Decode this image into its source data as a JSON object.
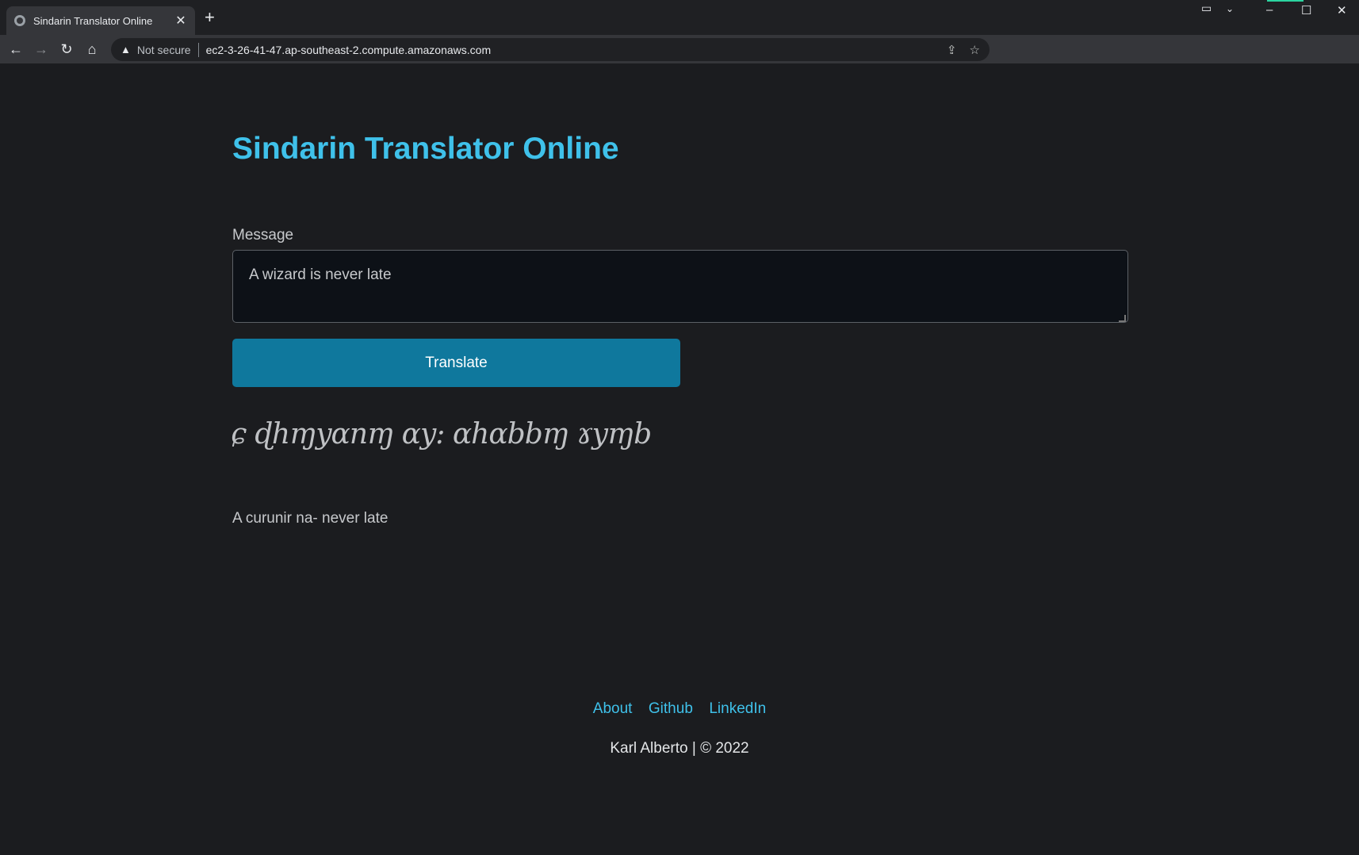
{
  "browser": {
    "tab_title": "Sindarin Translator Online",
    "tab_close": "✕",
    "new_tab": "+",
    "security_label": "Not secure",
    "url": "ec2-3-26-41-47.ap-southeast-2.compute.amazonaws.com",
    "window_controls": {
      "minimize": "–",
      "maximize": "☐",
      "close": "✕"
    }
  },
  "page": {
    "title": "Sindarin Translator Online",
    "message_label": "Message",
    "message_value": "A wizard is never late",
    "translate_button": "Translate",
    "tengwar_output": "ɕ ɖhɱyɑnɱ ɑy: ɑhɑbbɱ ɤyɱb",
    "translation_output": "A curunir na- never late"
  },
  "footer": {
    "links": [
      "About",
      "Github",
      "LinkedIn"
    ],
    "copyright": "Karl Alberto | © 2022"
  },
  "colors": {
    "accent": "#3fc1ea",
    "button": "#0f789d",
    "background": "#1b1c1f",
    "input_bg": "#0d1117"
  }
}
